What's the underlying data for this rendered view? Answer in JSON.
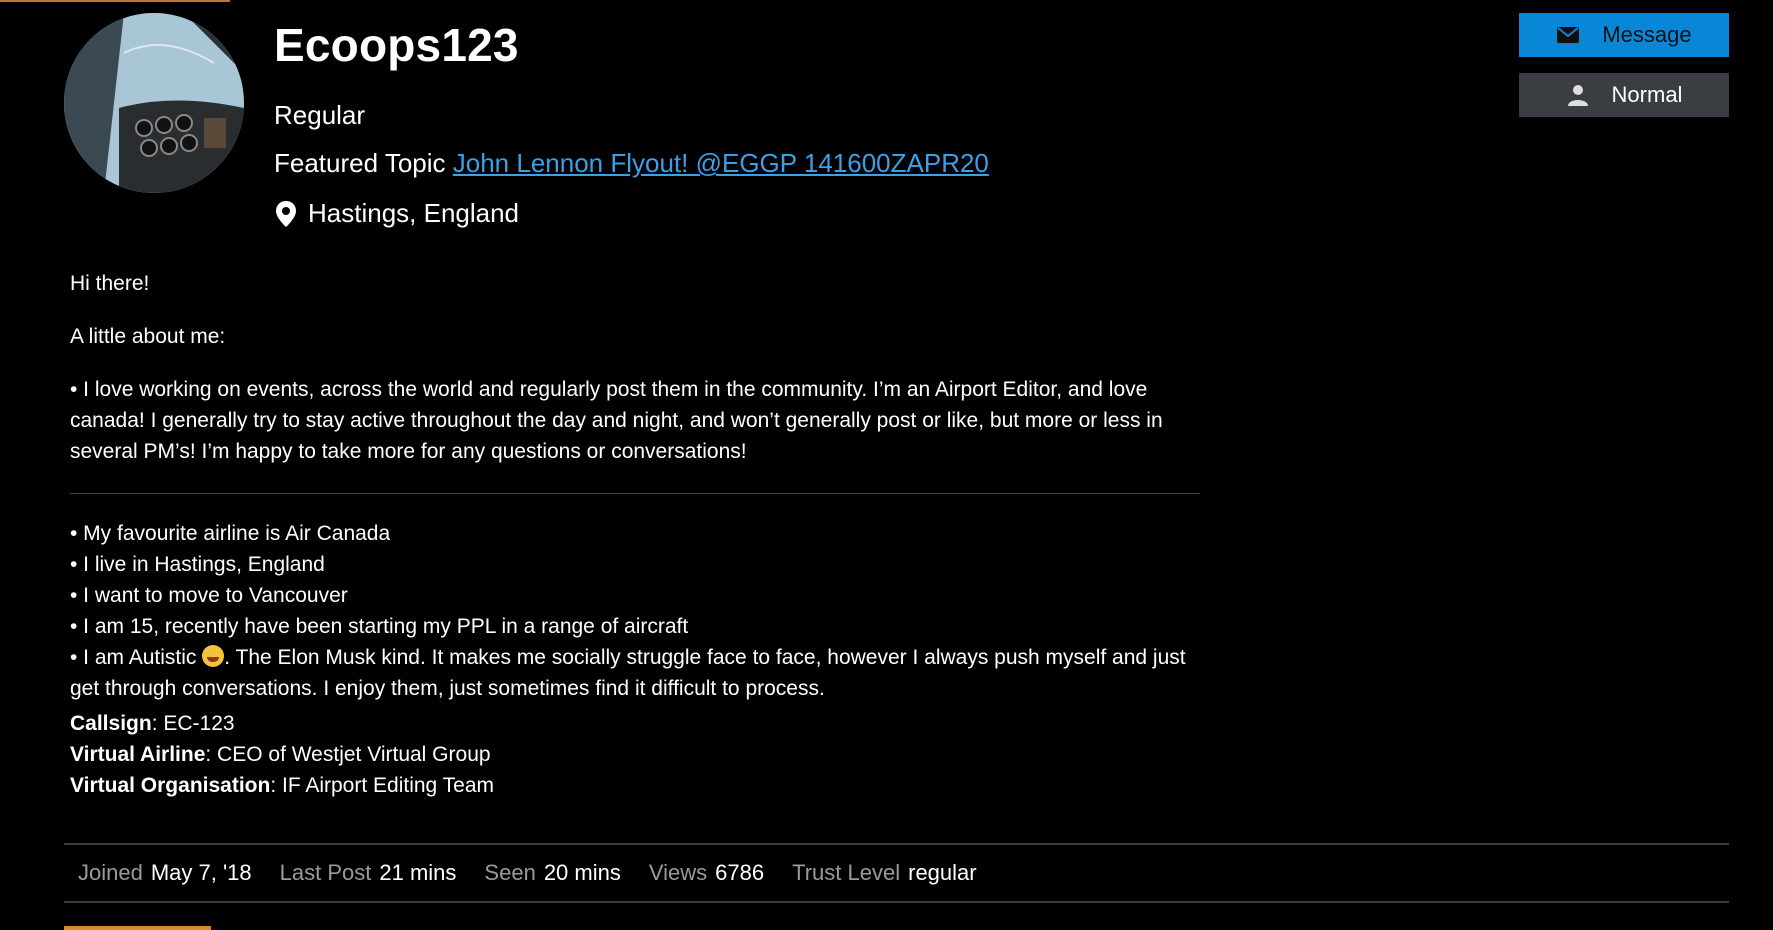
{
  "profile": {
    "username": "Ecoops123",
    "title": "Regular",
    "featured_label": "Featured Topic",
    "featured_link": "John Lennon Flyout! @EGGP 141600ZAPR20",
    "location": "Hastings, England"
  },
  "actions": {
    "message": "Message",
    "normal": "Normal"
  },
  "bio": {
    "greeting": "Hi there!",
    "about": "A little about me:",
    "intro": "• I love working on events, across the world and regularly post them in the community. I’m an Airport Editor, and love canada! I generally try to stay active throughout the day and night, and won’t generally post or like, but more or less in several PM’s! I’m happy to take more for any questions or conversations!",
    "bullets": [
      "• My favourite airline is Air Canada",
      "• I live in Hastings, England",
      "• I want to move to Vancouver",
      "• I am 15, recently have been starting my PPL in a range of aircraft"
    ],
    "autistic_prefix": "• I am Autistic",
    "autistic_rest": ". The Elon Musk kind. It makes me socially struggle face to face, however I always push myself and just get through conversations. I enjoy them, just sometimes find it difficult to process."
  },
  "fields": [
    {
      "label": "Callsign",
      "value": ": EC-123"
    },
    {
      "label": "Virtual Airline",
      "value": ": CEO of Westjet Virtual Group"
    },
    {
      "label": "Virtual Organisation",
      "value": ": IF Airport Editing Team"
    }
  ],
  "stats": [
    {
      "label": "Joined",
      "value": "May 7, '18"
    },
    {
      "label": "Last Post",
      "value": "21 mins"
    },
    {
      "label": "Seen",
      "value": "20 mins"
    },
    {
      "label": "Views",
      "value": "6786"
    },
    {
      "label": "Trust Level",
      "value": "regular"
    }
  ],
  "colors": {
    "link": "#3aa0e8",
    "message_button": "#0a86d6",
    "normal_button": "#3a3d42",
    "accent": "#d68a2c"
  }
}
